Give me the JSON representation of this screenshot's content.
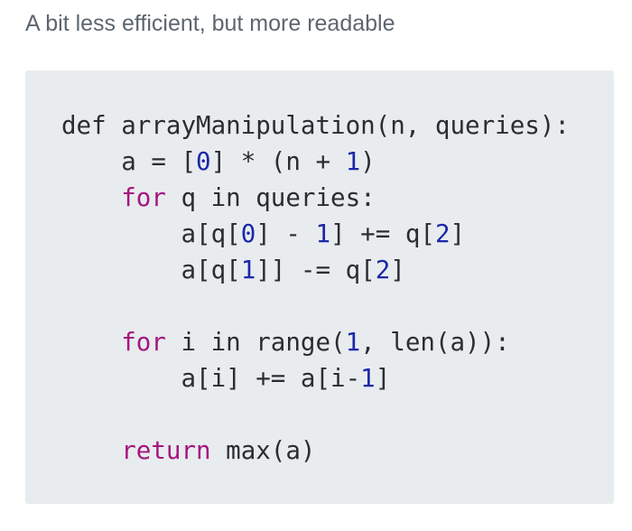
{
  "intro_text": "A bit less efficient, but more readable",
  "colors": {
    "code_background": "#e8ecee",
    "keyword": "#a51680",
    "number": "#1b28a8",
    "plain": "#2a2d31",
    "intro_text": "#5d6670"
  },
  "code": {
    "language": "python",
    "lines": [
      [
        {
          "t": "def arrayManipulation(n, queries):",
          "k": "pl"
        }
      ],
      [
        {
          "t": "    a = [",
          "k": "pl"
        },
        {
          "t": "0",
          "k": "num"
        },
        {
          "t": "] * (n + ",
          "k": "pl"
        },
        {
          "t": "1",
          "k": "num"
        },
        {
          "t": ")",
          "k": "pl"
        }
      ],
      [
        {
          "t": "    ",
          "k": "pl"
        },
        {
          "t": "for",
          "k": "kw"
        },
        {
          "t": " q in queries:",
          "k": "pl"
        }
      ],
      [
        {
          "t": "        a[q[",
          "k": "pl"
        },
        {
          "t": "0",
          "k": "num"
        },
        {
          "t": "] - ",
          "k": "pl"
        },
        {
          "t": "1",
          "k": "num"
        },
        {
          "t": "] += q[",
          "k": "pl"
        },
        {
          "t": "2",
          "k": "num"
        },
        {
          "t": "]",
          "k": "pl"
        }
      ],
      [
        {
          "t": "        a[q[",
          "k": "pl"
        },
        {
          "t": "1",
          "k": "num"
        },
        {
          "t": "]] -= q[",
          "k": "pl"
        },
        {
          "t": "2",
          "k": "num"
        },
        {
          "t": "]",
          "k": "pl"
        }
      ],
      [
        {
          "t": "",
          "k": "pl"
        }
      ],
      [
        {
          "t": "    ",
          "k": "pl"
        },
        {
          "t": "for",
          "k": "kw"
        },
        {
          "t": " i in range(",
          "k": "pl"
        },
        {
          "t": "1",
          "k": "num"
        },
        {
          "t": ", len(a)):",
          "k": "pl"
        }
      ],
      [
        {
          "t": "        a[i] += a[i-",
          "k": "pl"
        },
        {
          "t": "1",
          "k": "num"
        },
        {
          "t": "]",
          "k": "pl"
        }
      ],
      [
        {
          "t": "",
          "k": "pl"
        }
      ],
      [
        {
          "t": "    ",
          "k": "pl"
        },
        {
          "t": "return",
          "k": "kw"
        },
        {
          "t": " max(a)",
          "k": "pl"
        }
      ]
    ]
  }
}
